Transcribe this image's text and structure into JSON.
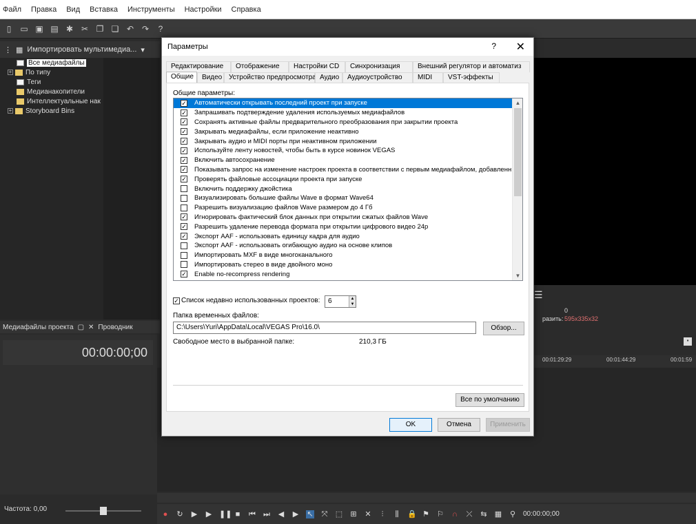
{
  "menu": [
    "Файл",
    "Правка",
    "Вид",
    "Вставка",
    "Инструменты",
    "Настройки",
    "Справка"
  ],
  "explorer": {
    "header": "Импортировать мультимедиа...",
    "tree": [
      {
        "label": "Все медиафайлы",
        "selected": true,
        "expander": ""
      },
      {
        "label": "По типу",
        "selected": false,
        "expander": "+"
      },
      {
        "label": "Теги",
        "selected": false,
        "expander": ""
      },
      {
        "label": "Медианакопители",
        "selected": false,
        "expander": ""
      },
      {
        "label": "Интеллектуальные нак",
        "selected": false,
        "expander": ""
      },
      {
        "label": "Storyboard Bins",
        "selected": false,
        "expander": "+"
      }
    ],
    "tabs": {
      "project_media": "Медиафайлы проекта",
      "explorer": "Проводник"
    }
  },
  "timecode": "00:00:00;00",
  "right_info": {
    "value": "0",
    "prefix": "разить:",
    "resolution": "595x335x32"
  },
  "ruler": {
    "t1": "00:01:29:29",
    "t2": "00:01:44:29",
    "t3": "00:01:59"
  },
  "transport": {
    "freq_label": "Частота: 0,00",
    "time": "00:00:00;00"
  },
  "dialog": {
    "title": "Параметры",
    "help": "?",
    "close": "✕",
    "tabs_row1": [
      "Редактирование",
      "Отображение",
      "Настройки CD",
      "Синхронизация",
      "Внешний регулятор и автоматиз"
    ],
    "tabs_row2": [
      "Общие",
      "Видео",
      "Устройство предпросмотра",
      "Аудио",
      "Аудиоустройство",
      "MIDI",
      "VST-эффекты"
    ],
    "active_tab": "Общие",
    "group_label": "Общие параметры:",
    "options": [
      {
        "label": "Автоматически открывать последний проект при запуске",
        "checked": true,
        "selected": true
      },
      {
        "label": "Запрашивать подтверждение удаления используемых медиафайлов",
        "checked": true
      },
      {
        "label": "Сохранять активные файлы предварительного преобразования при закрытии проекта",
        "checked": true
      },
      {
        "label": "Закрывать медиафайлы, если приложение неактивно",
        "checked": true
      },
      {
        "label": "Закрывать аудио и MIDI порты при неактивном приложении",
        "checked": true
      },
      {
        "label": "Используйте ленту новостей, чтобы быть в курсе новинок VEGAS",
        "checked": true
      },
      {
        "label": "Включить автосохранение",
        "checked": true
      },
      {
        "label": "Показывать запрос на изменение настроек проекта в соответствии с первым медиафайлом, добавленн",
        "checked": true
      },
      {
        "label": "Проверять файловые ассоциации проекта при запуске",
        "checked": true
      },
      {
        "label": "Включить поддержку джойстика",
        "checked": false
      },
      {
        "label": "Визуализировать большие файлы Wave в формат Wave64",
        "checked": false
      },
      {
        "label": "Разрешить визуализацию файлов Wave размером до 4 Гб",
        "checked": false
      },
      {
        "label": "Игнорировать фактический блок данных при открытии сжатых файлов Wave",
        "checked": true
      },
      {
        "label": "Разрешить удаление перевода формата при открытии цифрового видео 24p",
        "checked": true
      },
      {
        "label": "Экспорт AAF - использовать единицу кадра для аудио",
        "checked": true
      },
      {
        "label": "Экспорт AAF - использовать огибающую аудио на основе клипов",
        "checked": false
      },
      {
        "label": "Импортировать MXF в виде многоканального",
        "checked": false
      },
      {
        "label": "Импортировать стерео в виде двойного моно",
        "checked": false
      },
      {
        "label": "Enable no-recompress rendering",
        "checked": true
      }
    ],
    "recent_label": "Список недавно использованных проектов:",
    "recent_checked": true,
    "recent_value": "6",
    "temp_label": "Папка временных файлов:",
    "temp_path": "C:\\Users\\Yuri\\AppData\\Local\\VEGAS Pro\\16.0\\",
    "browse": "Обзор...",
    "free_label": "Свободное место в выбранной папке:",
    "free_value": "210,3 ГБ",
    "defaults": "Все по умолчанию",
    "ok": "OK",
    "cancel": "Отмена",
    "apply": "Применить"
  }
}
